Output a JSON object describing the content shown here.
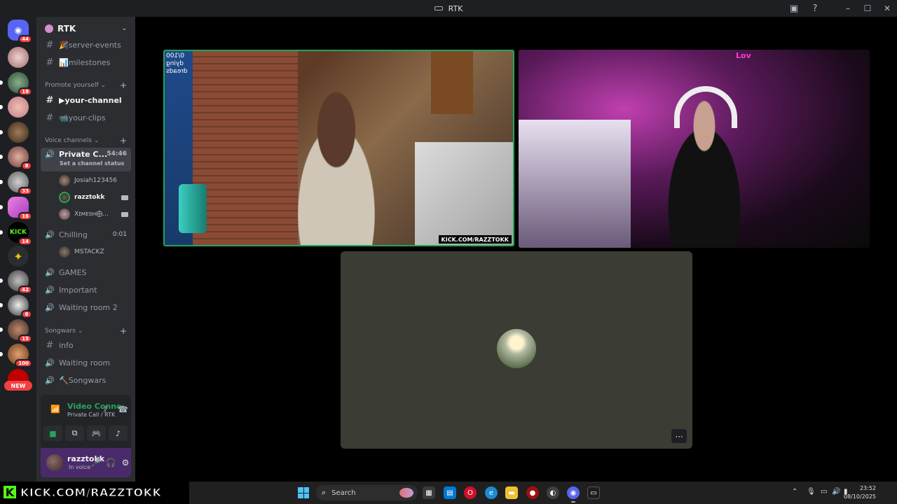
{
  "window": {
    "title": "RTK"
  },
  "rail": {
    "badges": [
      "44",
      "18",
      "8",
      "33",
      "16",
      "14",
      "42",
      "6",
      "15",
      "100"
    ],
    "new_label": "NEW"
  },
  "server": {
    "name": "RTK"
  },
  "channels": {
    "top": [
      {
        "name": "🎉server-events"
      },
      {
        "name": "📊milestones"
      }
    ],
    "promote_category": "Promote yourself",
    "promote": [
      {
        "name": "▶your-channel"
      },
      {
        "name": "📹your-clips"
      }
    ],
    "voice_category": "Voice channels",
    "private_call": {
      "name": "Private C...",
      "time": "54:46",
      "status": "Set a channel status"
    },
    "private_call_users": [
      {
        "name": "Josiah123456"
      },
      {
        "name": "razztokk"
      },
      {
        "name": "Xɪᴍᴇѕʜ⨁..."
      }
    ],
    "chilling": {
      "name": "Chilling",
      "time": "0:01"
    },
    "chilling_users": [
      {
        "name": "MSTACKZ"
      }
    ],
    "more_voice": [
      {
        "name": "GAMES"
      },
      {
        "name": "Important"
      },
      {
        "name": "Waiting room 2"
      }
    ],
    "songwars_category": "Songwars",
    "songwars": [
      {
        "name": "info",
        "type": "text"
      },
      {
        "name": "Waiting room",
        "type": "voice"
      },
      {
        "name": "🔨Songwars",
        "type": "voice"
      }
    ]
  },
  "voice_panel": {
    "title": "Video Connected",
    "subtitle": "Private Call / RTK"
  },
  "user": {
    "name": "razztokk",
    "status": "In voice"
  },
  "video": {
    "overlay_line1": "0/100",
    "overlay_line2": "dying dreads",
    "kick_tag": "KICK.COM/RAZZTOKK",
    "sign_text": "Lov"
  },
  "banner": {
    "k": "K",
    "text": "KICK.COM/RAZZTOKK"
  },
  "taskbar": {
    "search_placeholder": "Search",
    "time": "23:52",
    "date": "08/10/2025"
  },
  "colors": {
    "accent_green": "#23a55a",
    "badge_red": "#f23f43",
    "kick_green": "#53fc18"
  }
}
